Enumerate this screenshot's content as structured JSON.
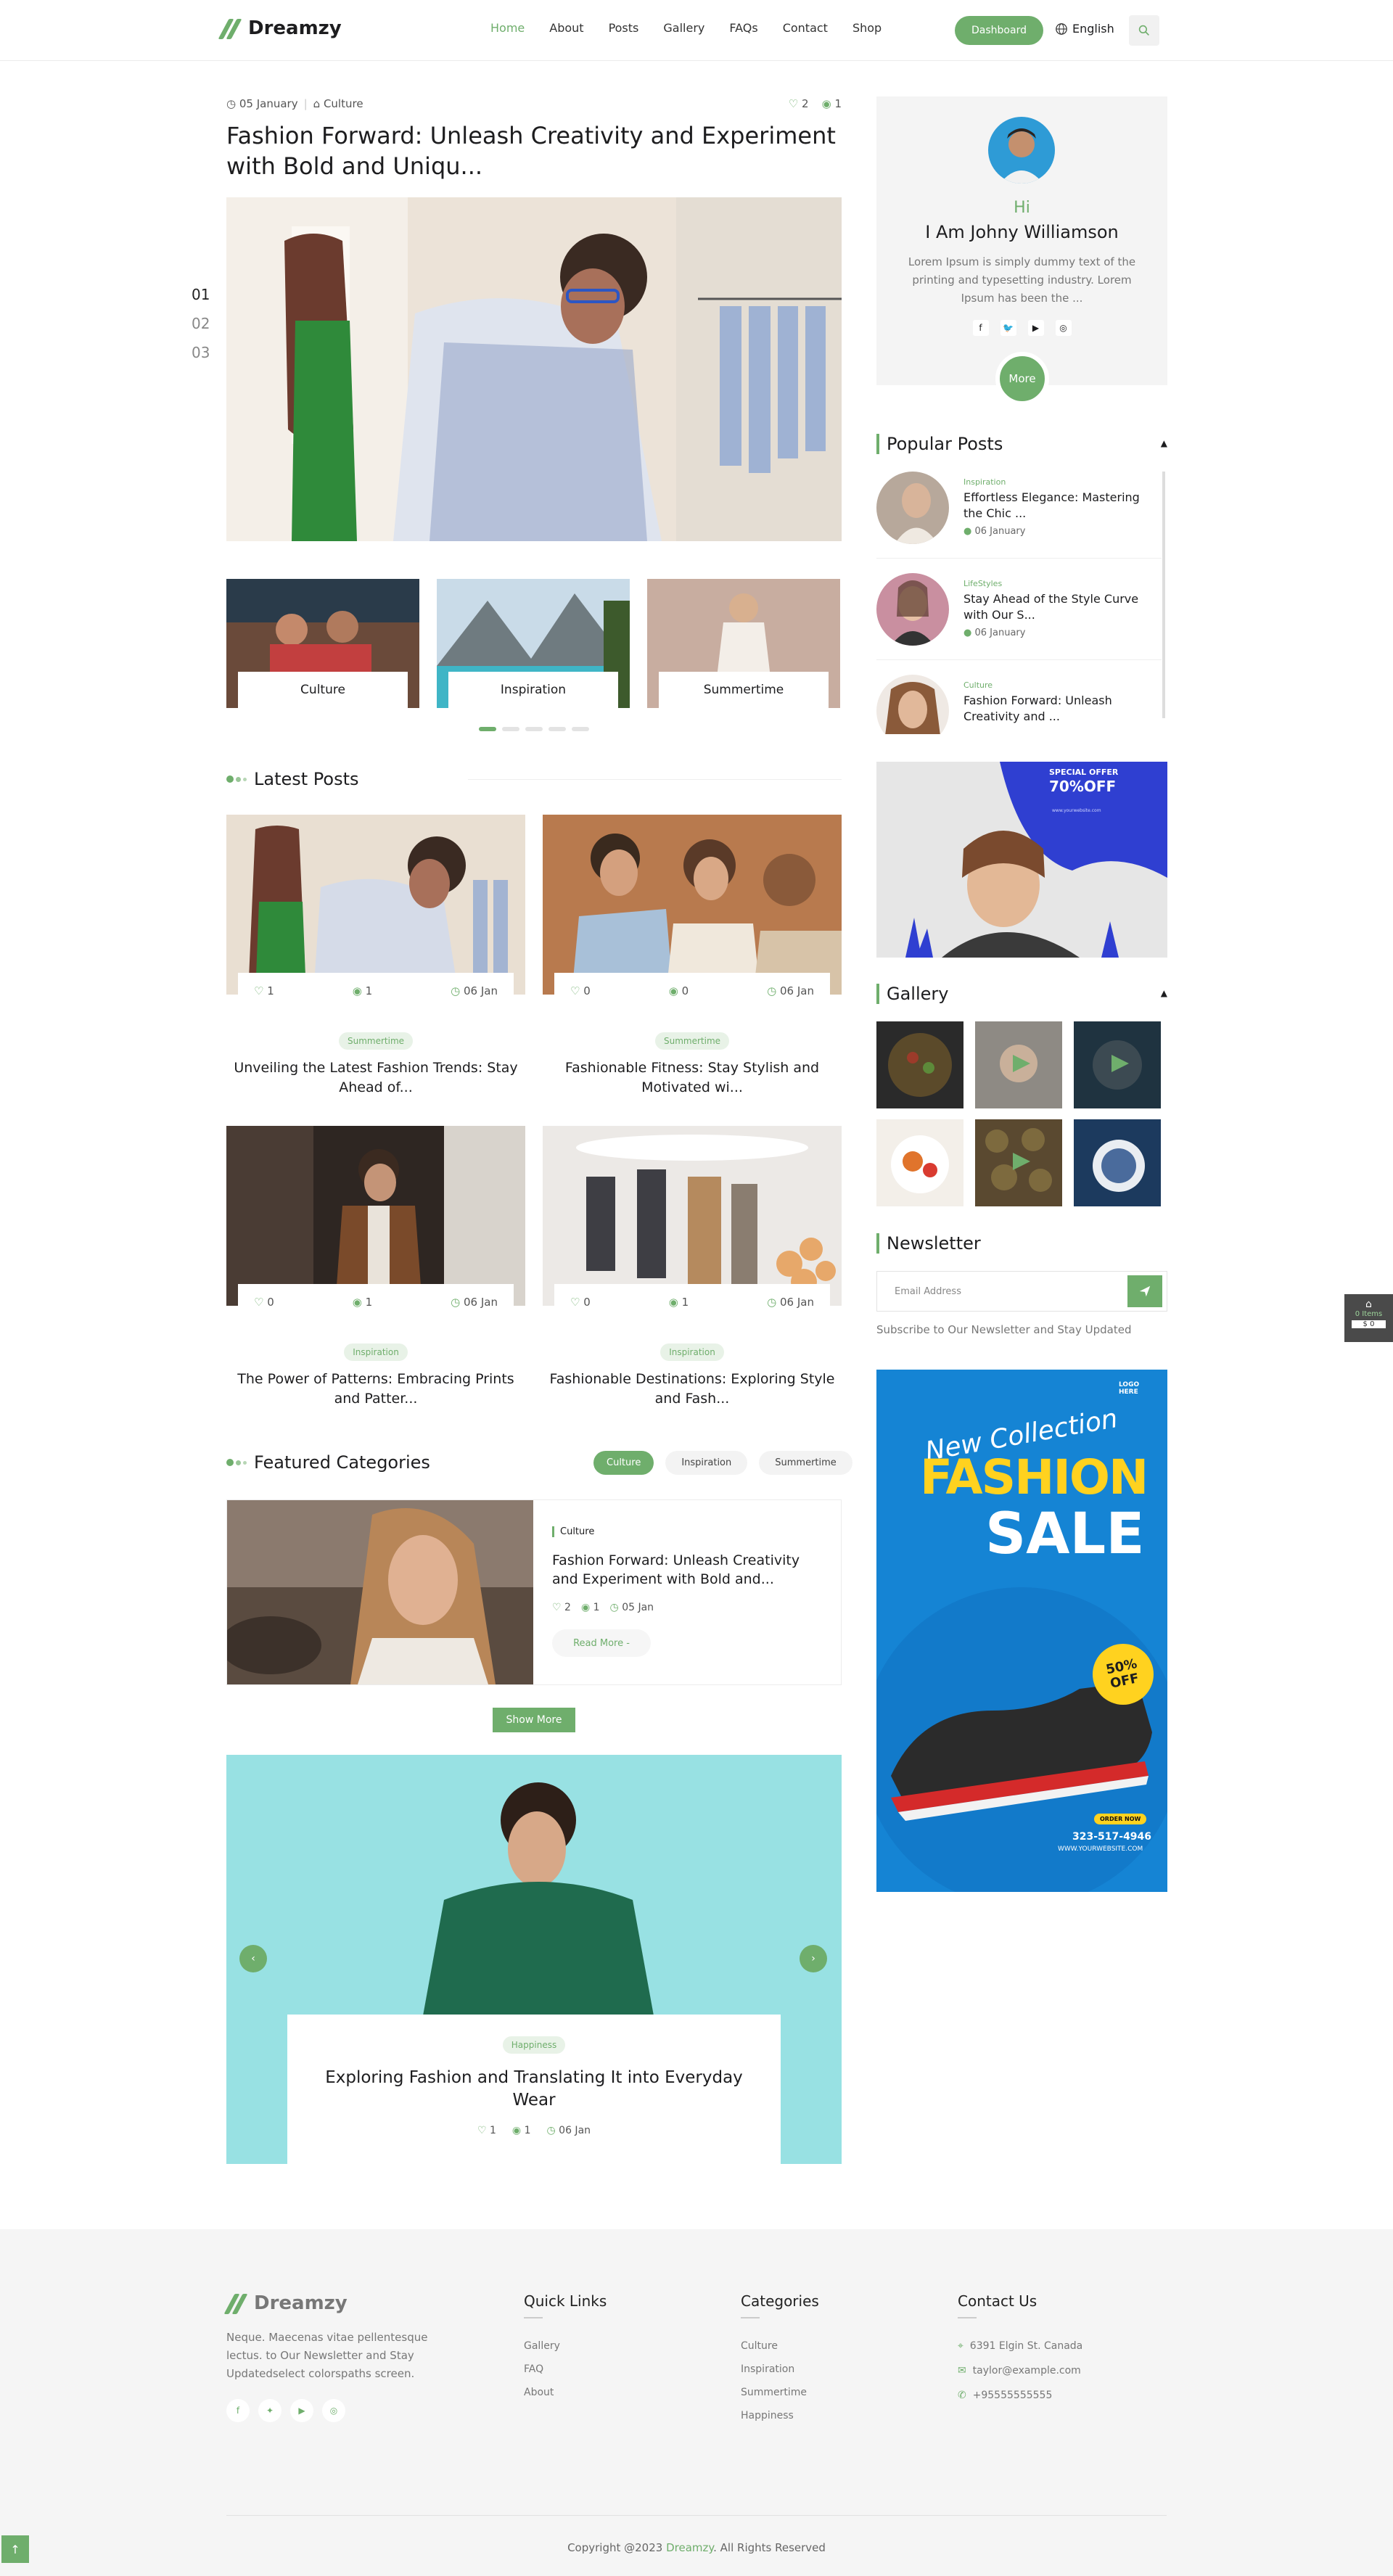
{
  "brand": {
    "name": "Dreamzy",
    "accent": "#6fae6c"
  },
  "nav": {
    "items": [
      "Home",
      "About",
      "Posts",
      "Gallery",
      "FAQs",
      "Contact",
      "Shop"
    ],
    "active": "Home",
    "dashboard": "Dashboard",
    "language": "English"
  },
  "hero": {
    "date": "05 January",
    "category": "Culture",
    "likes": "2",
    "views": "1",
    "title": "Fashion Forward: Unleash Creativity and Experiment with Bold and Uniqu...",
    "slides": [
      "01",
      "02",
      "03"
    ],
    "thumbs": [
      "Culture",
      "Inspiration",
      "Summertime"
    ]
  },
  "latest": {
    "title": "Latest Posts",
    "cards": [
      {
        "likes": "1",
        "views": "1",
        "date": "06 Jan",
        "tag": "Summertime",
        "title": "Unveiling the Latest Fashion Trends: Stay Ahead of..."
      },
      {
        "likes": "0",
        "views": "0",
        "date": "06 Jan",
        "tag": "Summertime",
        "title": "Fashionable Fitness: Stay Stylish and Motivated wi..."
      },
      {
        "likes": "0",
        "views": "1",
        "date": "06 Jan",
        "tag": "Inspiration",
        "title": "The Power of Patterns: Embracing Prints and Patter..."
      },
      {
        "likes": "0",
        "views": "1",
        "date": "06 Jan",
        "tag": "Inspiration",
        "title": "Fashionable Destinations: Exploring Style and Fash..."
      }
    ]
  },
  "featured": {
    "title": "Featured Categories",
    "tabs": [
      "Culture",
      "Inspiration",
      "Summertime"
    ],
    "active": "Culture",
    "post": {
      "category": "Culture",
      "title": "Fashion Forward: Unleash Creativity and Experiment with Bold and...",
      "likes": "2",
      "views": "1",
      "date": "05 Jan",
      "read_more": "Read More -"
    },
    "show_more": "Show More"
  },
  "banner": {
    "tag": "Happiness",
    "title": "Exploring Fashion and Translating It into Everyday Wear",
    "likes": "1",
    "views": "1",
    "date": "06 Jan"
  },
  "author": {
    "hi": "Hi",
    "name": "I Am Johny Williamson",
    "bio": "Lorem Ipsum is simply dummy text of the printing and typesetting industry. Lorem Ipsum has been the ...",
    "more": "More"
  },
  "popular": {
    "title": "Popular Posts",
    "items": [
      {
        "category": "Inspiration",
        "title": "Effortless Elegance: Mastering the Chic ...",
        "date": "06 January"
      },
      {
        "category": "LifeStyles",
        "title": "Stay Ahead of the Style Curve with Our S...",
        "date": "06 January"
      },
      {
        "category": "Culture",
        "title": "Fashion Forward: Unleash Creativity and ...",
        "date": ""
      }
    ]
  },
  "ad1": {
    "line1": "SPECIAL OFFER",
    "line2": "70%OFF",
    "line3": "www.yourwebsite.com"
  },
  "gallery": {
    "title": "Gallery"
  },
  "newsletter": {
    "title": "Newsletter",
    "placeholder": "Email Address",
    "note": "Subscribe to Our Newsletter and Stay Updated"
  },
  "ad2": {
    "line1": "New Collection",
    "line2": "FASHION",
    "line3": "SALE",
    "badge": "50% OFF",
    "phone": "323-517-4946",
    "site": "WWW.YOURWEBSITE.COM",
    "order": "ORDER NOW",
    "logo": "LOGO HERE"
  },
  "cart": {
    "items": "0 Items",
    "total": "$ 0"
  },
  "footer": {
    "about": "Neque. Maecenas vitae pellentesque lectus. to Our Newsletter and Stay Updatedselect colorspaths screen.",
    "quick_title": "Quick Links",
    "quick": [
      "Gallery",
      "FAQ",
      "About"
    ],
    "cat_title": "Categories",
    "cats": [
      "Culture",
      "Inspiration",
      "Summertime",
      "Happiness"
    ],
    "contact_title": "Contact Us",
    "address": "6391 Elgin St. Canada",
    "email": "taylor@example.com",
    "phone": "+95555555555",
    "copyright_pre": "Copyright @2023 ",
    "copyright_brand": "Dreamzy",
    "copyright_post": ". All Rights Reserved"
  }
}
